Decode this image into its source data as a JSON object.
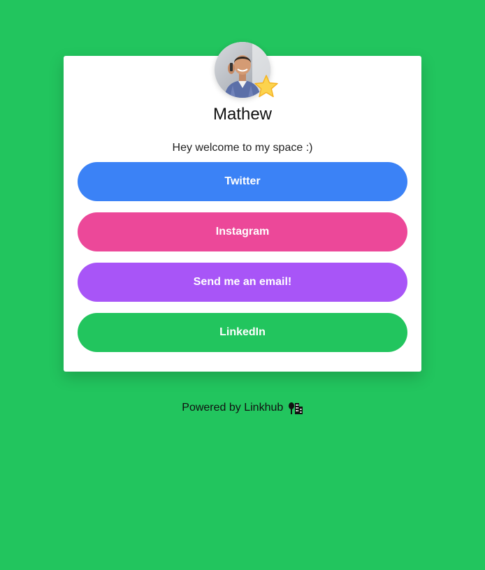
{
  "profile": {
    "name": "Mathew",
    "bio": "Hey welcome to my space :)",
    "avatar_icon": "person-photo",
    "badge_icon": "star-icon"
  },
  "links": [
    {
      "label": "Twitter",
      "color": "#3b82f6"
    },
    {
      "label": "Instagram",
      "color": "#ec4899"
    },
    {
      "label": "Send me an email!",
      "color": "#a855f7"
    },
    {
      "label": "LinkedIn",
      "color": "#22c55e"
    }
  ],
  "footer": {
    "text": "Powered by Linkhub",
    "icon": "city-icon"
  },
  "theme": {
    "background": "#22c55e",
    "card": "#ffffff"
  }
}
